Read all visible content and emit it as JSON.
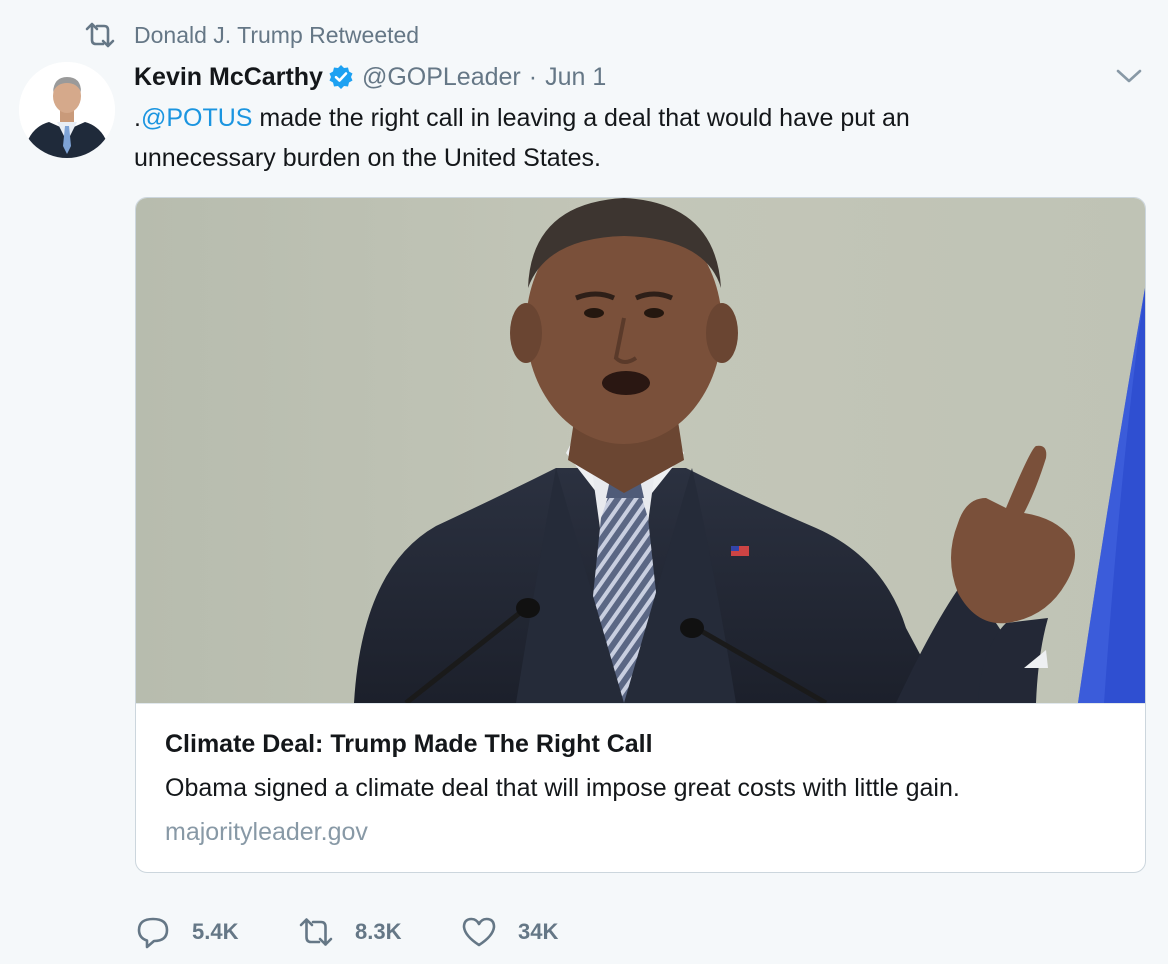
{
  "context": {
    "text": "Donald J. Trump Retweeted",
    "icon": "retweet-icon"
  },
  "author": {
    "name": "Kevin McCarthy",
    "verified": true,
    "handle": "@GOPLeader",
    "separator": "·",
    "time": "Jun 1"
  },
  "tweet": {
    "prefix": ".",
    "mention": "@POTUS",
    "text": " made the right call in leaving a deal that would have put an unnecessary burden on the United States."
  },
  "card": {
    "title": "Climate Deal: Trump Made The Right Call",
    "description": "Obama signed a climate deal that will impose great costs with little gain.",
    "domain": "majorityleader.gov"
  },
  "actions": {
    "replies": "5.4K",
    "retweets": "8.3K",
    "likes": "34K"
  },
  "colors": {
    "link": "#1b95e0",
    "muted": "#657786",
    "verified": "#1da1f2",
    "background": "#f5f8fa"
  }
}
